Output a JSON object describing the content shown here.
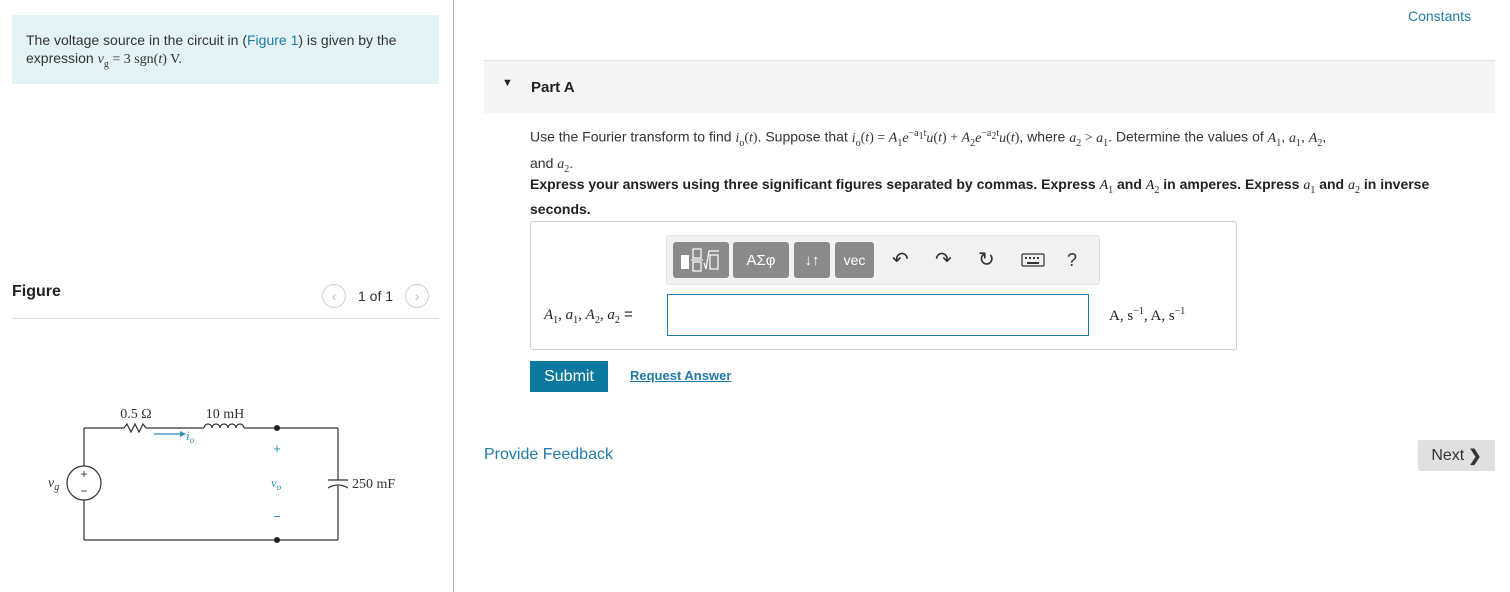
{
  "problem": {
    "intro_prefix": "The voltage source in the circuit in (",
    "figure_link": "Figure 1",
    "intro_suffix": ") is given by the",
    "intro_line2_prefix": "expression ",
    "expression": "v_g = 3 sgn(t) V."
  },
  "figure": {
    "title": "Figure",
    "pager": "1 of 1",
    "circuit": {
      "resistor": "0.5 Ω",
      "inductor": "10 mH",
      "capacitor": "250 mF",
      "source_label": "v",
      "source_sub": "g",
      "current_label": "i",
      "current_sub": "o",
      "output_label": "v",
      "output_sub": "o",
      "plus": "+",
      "minus": "−"
    }
  },
  "header": {
    "constants_link": "Constants"
  },
  "part": {
    "title": "Part A",
    "question": {
      "t1": "Use the Fourier transform to find ",
      "t2": ". Suppose that ",
      "t3": ", where ",
      "t4": ". Determine the values of ",
      "t5": "and "
    },
    "instructions": {
      "t1": "Express your answers using three significant figures separated by commas. Express ",
      "t2": " and ",
      "t3": " in amperes. Express ",
      "t4": " and ",
      "t5": " in inverse seconds."
    }
  },
  "answer": {
    "toolbar": {
      "greek_label": "ΑΣφ",
      "arrows_label": "↓↑",
      "vec_label": "vec",
      "help_label": "?"
    },
    "input_value": "",
    "input_placeholder": ""
  },
  "actions": {
    "submit_label": "Submit",
    "request_answer_label": "Request Answer",
    "feedback_label": "Provide Feedback",
    "next_label": "Next"
  }
}
